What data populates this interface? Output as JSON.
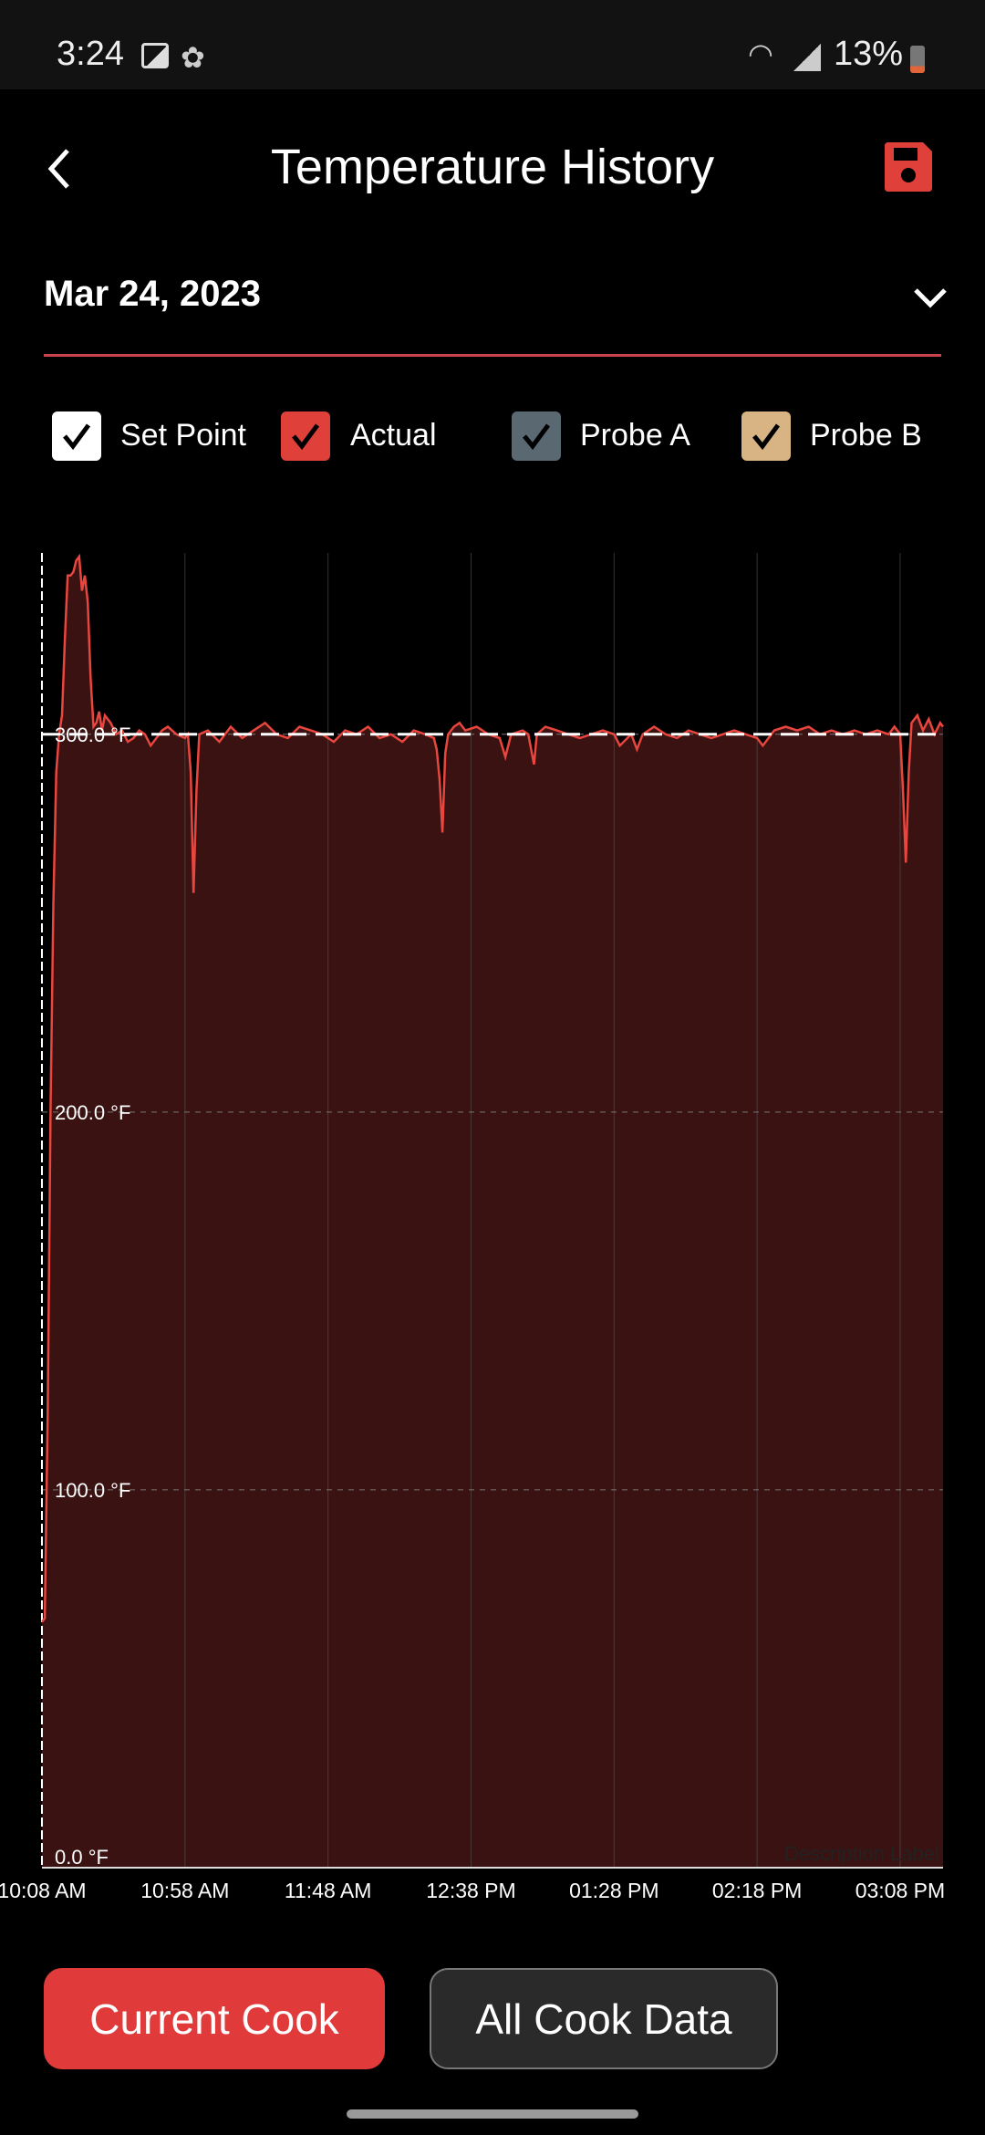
{
  "status_bar": {
    "time": "3:24",
    "battery": "13%",
    "icons": [
      "gallery-icon",
      "app-notification-icon",
      "wifi-icon",
      "signal-icon",
      "battery-icon"
    ]
  },
  "header": {
    "title": "Temperature History",
    "back_icon": "chevron-left-icon",
    "save_icon": "floppy-disk-icon"
  },
  "date_selector": {
    "value": "Mar 24, 2023",
    "icon": "chevron-down-icon"
  },
  "legend": [
    {
      "label": "Set Point",
      "checked": true,
      "color": "#ffffff"
    },
    {
      "label": "Actual",
      "checked": true,
      "color": "#e0403a"
    },
    {
      "label": "Probe A",
      "checked": true,
      "color": "#5a6872"
    },
    {
      "label": "Probe B",
      "checked": true,
      "color": "#d8b484"
    }
  ],
  "buttons": {
    "current_cook": "Current Cook",
    "all_cook_data": "All Cook Data"
  },
  "colors": {
    "accent": "#e03a3a",
    "fill": "#3a1212",
    "line": "#e8463e"
  },
  "chart_data": {
    "type": "area",
    "ylim": [
      0,
      348
    ],
    "xlim": [
      "10:08",
      "15:23"
    ],
    "y_ticks": [
      "0.0 °F",
      "100.0 °F",
      "200.0 °F",
      "300.0 °F"
    ],
    "y_tick_values": [
      0,
      100,
      200,
      300
    ],
    "x_ticks": [
      "10:08 AM",
      "10:58 AM",
      "11:48 AM",
      "12:38 PM",
      "01:28 PM",
      "02:18 PM",
      "03:08 PM"
    ],
    "x_tick_times": [
      "10:08",
      "10:58",
      "11:48",
      "12:38",
      "13:28",
      "14:18",
      "15:08"
    ],
    "grid": true,
    "description_label": "Description Label",
    "set_point": {
      "value": 300
    },
    "series": [
      {
        "name": "Actual",
        "points": [
          [
            "10:08",
            65
          ],
          [
            "10:09",
            66
          ],
          [
            "10:10",
            120
          ],
          [
            "10:11",
            200
          ],
          [
            "10:12",
            255
          ],
          [
            "10:13",
            290
          ],
          [
            "10:14",
            300
          ],
          [
            "10:15",
            305
          ],
          [
            "10:16",
            325
          ],
          [
            "10:17",
            342
          ],
          [
            "10:18",
            342
          ],
          [
            "10:19",
            343
          ],
          [
            "10:20",
            346
          ],
          [
            "10:21",
            347
          ],
          [
            "10:22",
            338
          ],
          [
            "10:23",
            342
          ],
          [
            "10:24",
            335
          ],
          [
            "10:25",
            315
          ],
          [
            "10:26",
            302
          ],
          [
            "10:27",
            303
          ],
          [
            "10:28",
            306
          ],
          [
            "10:29",
            301
          ],
          [
            "10:30",
            305
          ],
          [
            "10:32",
            303
          ],
          [
            "10:34",
            300
          ],
          [
            "10:36",
            301
          ],
          [
            "10:38",
            298
          ],
          [
            "10:40",
            299
          ],
          [
            "10:42",
            301
          ],
          [
            "10:44",
            300
          ],
          [
            "10:46",
            297
          ],
          [
            "10:48",
            299
          ],
          [
            "10:50",
            301
          ],
          [
            "10:52",
            302
          ],
          [
            "10:55",
            300
          ],
          [
            "10:58",
            299
          ],
          [
            "10:59",
            300
          ],
          [
            "11:00",
            290
          ],
          [
            "11:01",
            258
          ],
          [
            "11:02",
            285
          ],
          [
            "11:03",
            300
          ],
          [
            "11:06",
            301
          ],
          [
            "11:10",
            298
          ],
          [
            "11:14",
            302
          ],
          [
            "11:18",
            299
          ],
          [
            "11:22",
            301
          ],
          [
            "11:26",
            303
          ],
          [
            "11:30",
            300
          ],
          [
            "11:34",
            299
          ],
          [
            "11:38",
            302
          ],
          [
            "11:42",
            301
          ],
          [
            "11:46",
            300
          ],
          [
            "11:50",
            298
          ],
          [
            "11:54",
            301
          ],
          [
            "11:58",
            300
          ],
          [
            "12:02",
            302
          ],
          [
            "12:06",
            299
          ],
          [
            "12:10",
            300
          ],
          [
            "12:14",
            298
          ],
          [
            "12:18",
            301
          ],
          [
            "12:22",
            300
          ],
          [
            "12:25",
            299
          ],
          [
            "12:26",
            296
          ],
          [
            "12:27",
            288
          ],
          [
            "12:28",
            274
          ],
          [
            "12:29",
            295
          ],
          [
            "12:30",
            300
          ],
          [
            "12:32",
            302
          ],
          [
            "12:34",
            303
          ],
          [
            "12:36",
            301
          ],
          [
            "12:40",
            302
          ],
          [
            "12:44",
            300
          ],
          [
            "12:48",
            299
          ],
          [
            "12:50",
            294
          ],
          [
            "12:52",
            300
          ],
          [
            "12:56",
            301
          ],
          [
            "12:58",
            300
          ],
          [
            "13:00",
            292
          ],
          [
            "13:01",
            300
          ],
          [
            "13:04",
            302
          ],
          [
            "13:08",
            301
          ],
          [
            "13:12",
            300
          ],
          [
            "13:16",
            299
          ],
          [
            "13:20",
            300
          ],
          [
            "13:24",
            301
          ],
          [
            "13:28",
            300
          ],
          [
            "13:30",
            297
          ],
          [
            "13:34",
            300
          ],
          [
            "13:36",
            296
          ],
          [
            "13:38",
            300
          ],
          [
            "13:42",
            302
          ],
          [
            "13:46",
            300
          ],
          [
            "13:50",
            299
          ],
          [
            "13:54",
            301
          ],
          [
            "13:58",
            300
          ],
          [
            "14:02",
            299
          ],
          [
            "14:06",
            300
          ],
          [
            "14:10",
            301
          ],
          [
            "14:14",
            300
          ],
          [
            "14:18",
            299
          ],
          [
            "14:20",
            297
          ],
          [
            "14:24",
            301
          ],
          [
            "14:28",
            302
          ],
          [
            "14:32",
            301
          ],
          [
            "14:36",
            302
          ],
          [
            "14:40",
            300
          ],
          [
            "14:44",
            301
          ],
          [
            "14:48",
            300
          ],
          [
            "14:52",
            301
          ],
          [
            "14:56",
            300
          ],
          [
            "15:00",
            301
          ],
          [
            "15:04",
            300
          ],
          [
            "15:06",
            302
          ],
          [
            "15:08",
            300
          ],
          [
            "15:09",
            285
          ],
          [
            "15:10",
            266
          ],
          [
            "15:11",
            290
          ],
          [
            "15:12",
            303
          ],
          [
            "15:14",
            305
          ],
          [
            "15:16",
            301
          ],
          [
            "15:18",
            304
          ],
          [
            "15:20",
            300
          ],
          [
            "15:22",
            303
          ],
          [
            "15:23",
            302
          ]
        ]
      }
    ]
  }
}
